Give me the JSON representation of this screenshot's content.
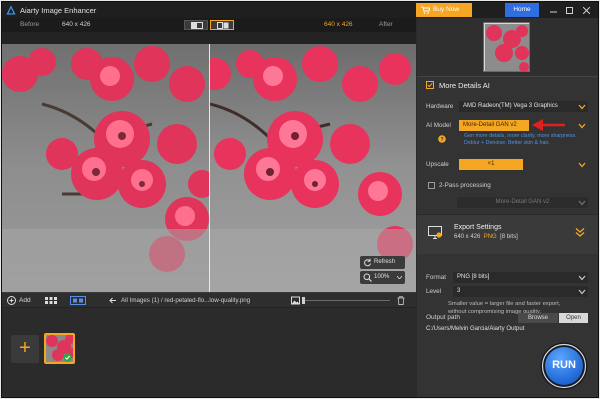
{
  "titlebar": {
    "app_title": "Aiarty Image Enhancer",
    "buy_label": "Buy Now",
    "home_label": "Home",
    "cart_icon": "cart-icon",
    "window_controls": [
      "minimize-icon",
      "maximize-icon",
      "close-icon"
    ]
  },
  "compare": {
    "before_label": "Before",
    "before_resolution": "640 x 426",
    "after_resolution": "640 x 426",
    "after_label": "After",
    "view_modes": [
      "split-view-icon",
      "side-by-side-icon"
    ]
  },
  "preview": {
    "refresh_label": "Refresh",
    "zoom_level": "100%"
  },
  "file_bar": {
    "add_label": "Add",
    "breadcrumb": "All Images (1)  /  red-petaled-flo...low-quality.png"
  },
  "right": {
    "more_details_title": "More Details AI",
    "hardware_label": "Hardware",
    "hardware_value": "AMD Radeon(TM) Vega 3 Graphics",
    "ai_model_label": "AI Model",
    "ai_model_value": "More-Detail GAN v2",
    "ai_model_hint_1": "Gen more details, more clarity, more sharpness.",
    "ai_model_hint_2": "Deblur + Denoise. Better skin & hair.",
    "upscale_label": "Upscale",
    "upscale_value": "×1",
    "two_pass_label": "2-Pass processing",
    "two_pass_model": "More-Detail GAN v2"
  },
  "export": {
    "title": "Export Settings",
    "size": "640 x 426",
    "format_badge": "PNG",
    "bits": "[8 bits]",
    "format_label": "Format",
    "format_value": "PNG  [8 bits]",
    "level_label": "Level",
    "level_value": "3",
    "level_note_1": "Smaller value = larger file and faster export,",
    "level_note_2": "without compromising image quality.",
    "output_label": "Output path",
    "browse_label": "Browse",
    "open_label": "Open",
    "output_path": "C:/Users/Melvin Garcia/Aiarty Output",
    "run_label": "RUN"
  },
  "colors": {
    "accent": "#f5a623",
    "primary_blue": "#2f6ee0",
    "annotation_red": "#e0201c",
    "panel_bg": "#333333"
  }
}
